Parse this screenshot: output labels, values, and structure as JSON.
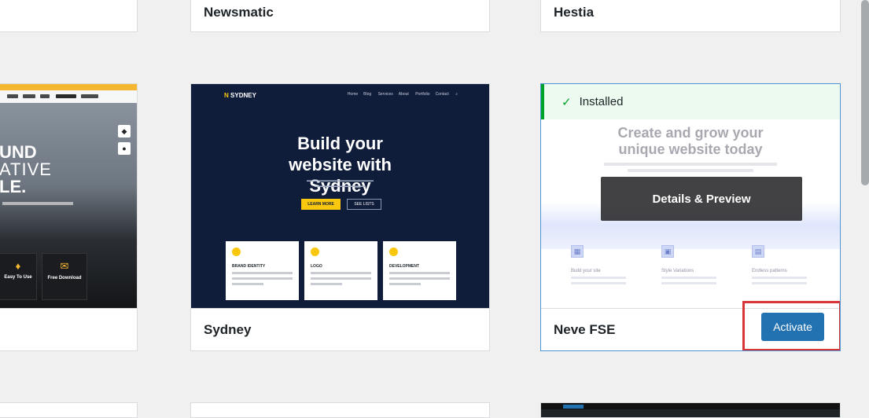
{
  "themes": {
    "top_row": [
      {
        "name": "Newsmatic"
      },
      {
        "name": "Hestia"
      }
    ],
    "sydney": {
      "name": "Sydney",
      "preview_logo": "SYDNEY",
      "preview_nav": [
        "Home",
        "Blog",
        "Services",
        "About",
        "Portfolio",
        "Contact"
      ],
      "preview_title": "Build your website with Sydney",
      "preview_btn1": "LEARN MORE",
      "preview_btn2": "SEE LISTS",
      "preview_features": [
        "BRAND IDENTITY",
        "LOGO",
        "DEVELOPMENT"
      ]
    },
    "neve_fse": {
      "name": "Neve FSE",
      "installed_label": "Installed",
      "preview_title": "Create and grow your unique website today",
      "preview_features": [
        "Build your site",
        "Style Variations",
        "Endless patterns"
      ],
      "details_label": "Details & Preview",
      "activate_label": "Activate"
    },
    "left_partial": {
      "hero_lines": [
        "UND",
        "ATIVE",
        "LE."
      ],
      "features": [
        "Easy To Use",
        "Free Download"
      ]
    }
  },
  "colors": {
    "accent_blue": "#2271b1",
    "installed_green": "#00a32a",
    "highlight_red": "#d63638"
  }
}
